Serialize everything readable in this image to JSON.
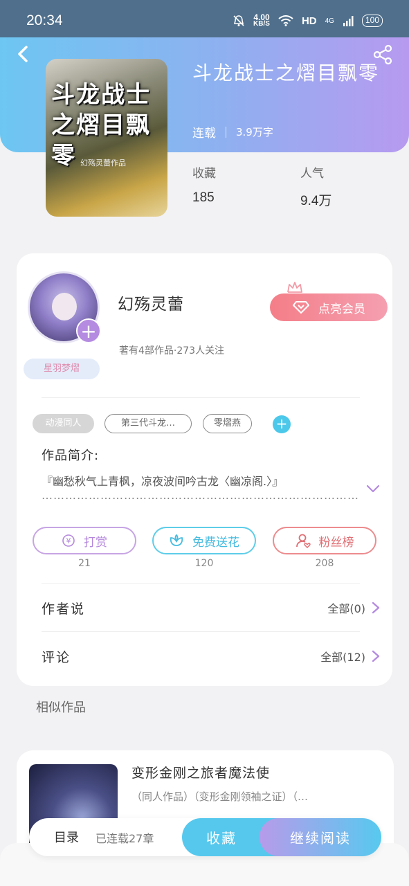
{
  "status_bar": {
    "time": "20:34",
    "net_speed_value": "4.00",
    "net_speed_unit": "KB/S",
    "hd": "HD",
    "signal": "4G",
    "battery": "100"
  },
  "book": {
    "title": "斗龙战士之熠目飘零",
    "status": "连载",
    "word_count": "3.9万字",
    "cover_title": "斗龙战士之熠目飘零",
    "cover_subtitle": "幻殇灵蕾作品"
  },
  "stats": [
    {
      "label": "收藏",
      "value": "185"
    },
    {
      "label": "人气",
      "value": "9.4万"
    }
  ],
  "author": {
    "name": "幻殇灵蕾",
    "stats": "著有4部作品·273人关注",
    "badge": "星羽梦熠",
    "vip_button": "点亮会员"
  },
  "tags": [
    "动漫同人",
    "第三代斗龙…",
    "零熠燕"
  ],
  "intro": {
    "label": "作品简介:",
    "text": "『幽愁秋气上青枫，凉夜波间吟古龙〈幽凉阁.〉』",
    "dots": "………………………………………………………………………"
  },
  "actions": [
    {
      "label": "打赏",
      "count": "21",
      "icon": "yuan-coin-icon"
    },
    {
      "label": "免费送花",
      "count": "120",
      "icon": "flower-icon"
    },
    {
      "label": "粉丝榜",
      "count": "208",
      "icon": "fan-user-icon"
    }
  ],
  "rows": [
    {
      "label": "作者说",
      "value": "全部(0)"
    },
    {
      "label": "评论",
      "value": "全部(12)"
    }
  ],
  "similar": {
    "label": "相似作品",
    "title": "变形金刚之旅者魔法使",
    "tags": "（同人作品）（变形金刚领袖之证）（…"
  },
  "bottom": {
    "toc": "目录",
    "toc_count": "已连载27章",
    "collect": "收藏",
    "read": "继续阅读"
  },
  "colors": {
    "header_gradient_start": "#6dc6f2",
    "header_gradient_end": "#b79af0",
    "accent_blue": "#56c8ee",
    "accent_purple": "#b79bea",
    "vip_pink": "#f47e88"
  }
}
